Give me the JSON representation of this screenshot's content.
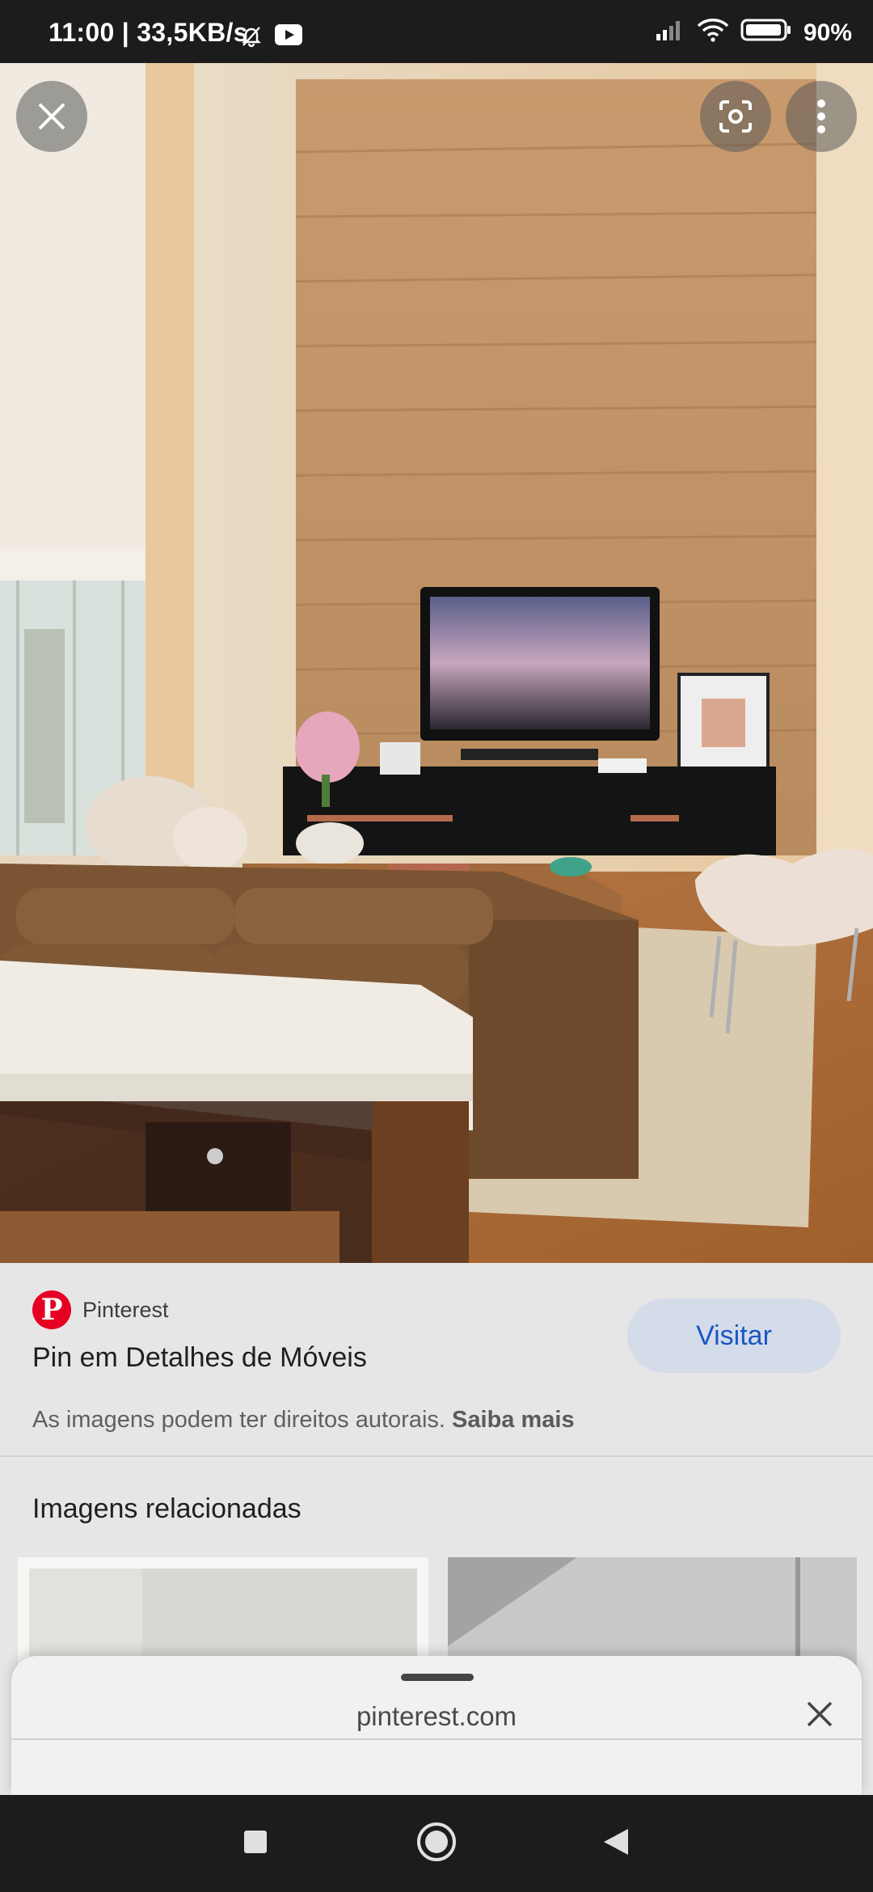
{
  "status": {
    "time_speed": "11:00 | 33,5KB/s",
    "battery": "90%",
    "icons": [
      "mute-bell-icon",
      "youtube-icon",
      "signal-icon",
      "wifi-icon",
      "battery-icon"
    ]
  },
  "viewer": {
    "close_icon": "close-icon",
    "lens_icon": "lens-icon",
    "more_icon": "more-vert-icon"
  },
  "result": {
    "source": "Pinterest",
    "title": "Pin em Detalhes de Móveis",
    "visit_label": "Visitar",
    "copyright_text": "As imagens podem ter direitos autorais.",
    "learn_more": "Saiba mais"
  },
  "related": {
    "heading": "Imagens relacionadas"
  },
  "sheet": {
    "url": "pinterest.com"
  },
  "colors": {
    "pinterest_red": "#e60023",
    "visit_bg": "#d4dcea",
    "visit_text": "#1a57c4"
  }
}
